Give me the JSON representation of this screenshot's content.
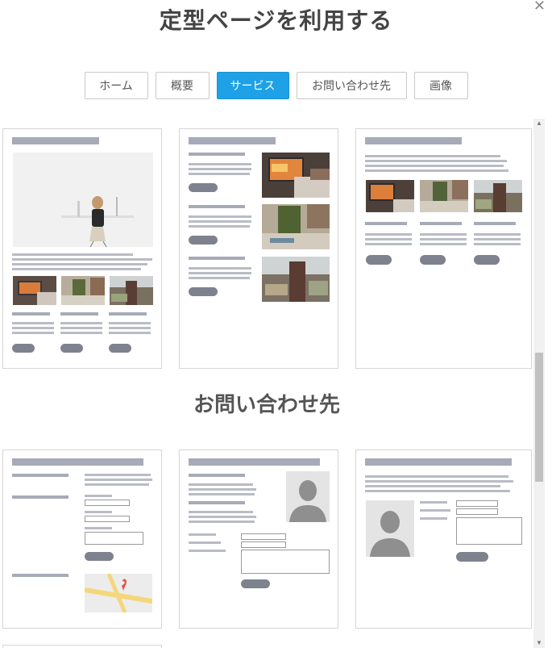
{
  "dialog": {
    "title": "定型ページを利用する",
    "close_icon": "close-icon"
  },
  "tabs": [
    {
      "label": "ホーム",
      "active": false
    },
    {
      "label": "概要",
      "active": false
    },
    {
      "label": "サービス",
      "active": true
    },
    {
      "label": "お問い合わせ先",
      "active": false
    },
    {
      "label": "画像",
      "active": false
    }
  ],
  "sections": {
    "contact_title": "お問い合わせ先"
  },
  "colors": {
    "accent": "#1ea1e6",
    "placeholder_bar": "#a7abb8",
    "pill": "#7e828f"
  },
  "scrollbar": {
    "up_icon": "arrow-up-icon",
    "down_icon": "arrow-down-icon"
  }
}
